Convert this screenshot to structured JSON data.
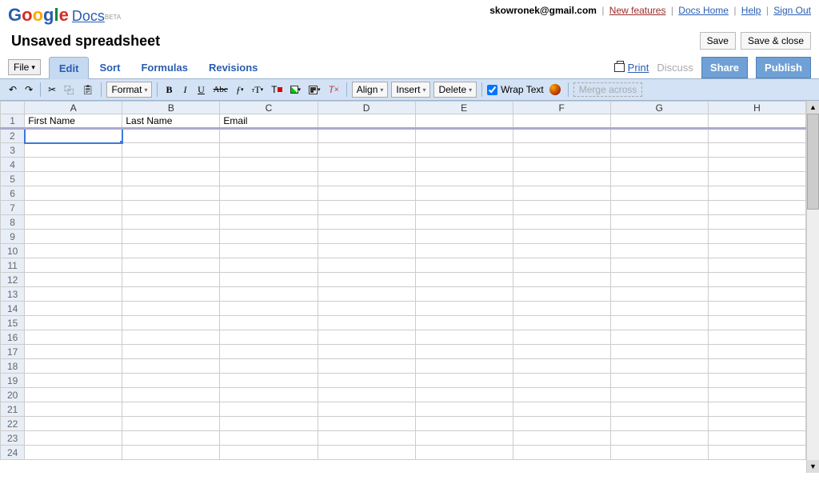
{
  "logo": {
    "docs": "Docs",
    "beta": "BETA"
  },
  "user": {
    "email": "skowronek@gmail.com",
    "new_features": "New features",
    "docs_home": "Docs Home",
    "help": "Help",
    "sign_out": "Sign Out"
  },
  "doc": {
    "title": "Unsaved spreadsheet",
    "save": "Save",
    "save_close": "Save & close"
  },
  "file_menu": "File",
  "tabs": {
    "edit": "Edit",
    "sort": "Sort",
    "formulas": "Formulas",
    "revisions": "Revisions"
  },
  "right_actions": {
    "print": "Print",
    "discuss": "Discuss",
    "share": "Share",
    "publish": "Publish"
  },
  "toolbar": {
    "format": "Format",
    "align": "Align",
    "insert": "Insert",
    "delete": "Delete",
    "wrap": "Wrap Text",
    "merge": "Merge across"
  },
  "columns": [
    "A",
    "B",
    "C",
    "D",
    "E",
    "F",
    "G",
    "H"
  ],
  "row_count": 24,
  "data": {
    "r1c1": "First Name",
    "r1c2": "Last Name",
    "r1c3": "Email"
  },
  "selected": {
    "row": 2,
    "col": 1
  }
}
